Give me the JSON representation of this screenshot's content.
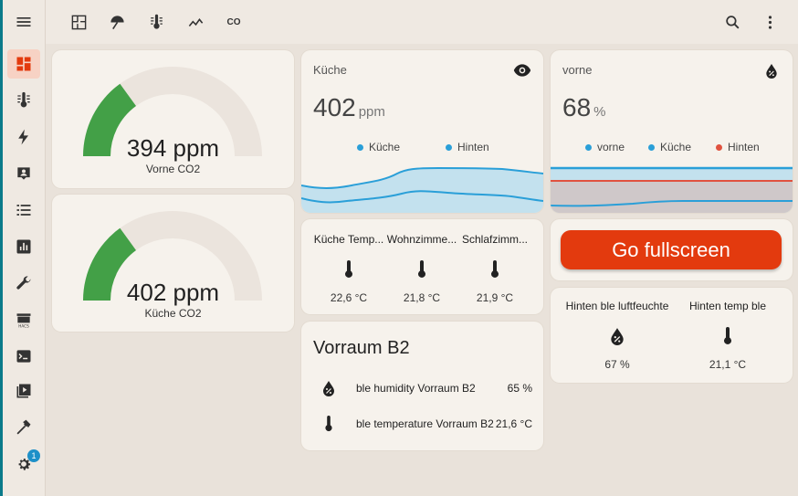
{
  "sidebar": {
    "items": [
      {
        "name": "overview",
        "icon": "dashboard-icon",
        "active": true
      },
      {
        "name": "climate",
        "icon": "thermometer-icon"
      },
      {
        "name": "energy",
        "icon": "lightning-icon"
      },
      {
        "name": "map",
        "icon": "account-box-icon"
      },
      {
        "name": "logbook",
        "icon": "list-icon"
      },
      {
        "name": "history",
        "icon": "chart-box-icon"
      },
      {
        "name": "tools",
        "icon": "wrench-icon"
      },
      {
        "name": "hacs",
        "icon": "hacs-store-icon",
        "label": "HACS"
      },
      {
        "name": "terminal",
        "icon": "terminal-icon"
      },
      {
        "name": "media",
        "icon": "media-play-icon"
      },
      {
        "name": "developer",
        "icon": "hammer-icon"
      },
      {
        "name": "settings",
        "icon": "gear-icon",
        "badge": "1"
      }
    ]
  },
  "topbar": {
    "views": [
      "floorplan-icon",
      "weather-icon",
      "thermometer-icon",
      "trend-icon",
      "co-icon"
    ],
    "co_label": "CO"
  },
  "gauges": [
    {
      "value": "394 ppm",
      "name": "Vorne CO2",
      "fraction": 0.3
    },
    {
      "value": "402 ppm",
      "name": "Küche CO2",
      "fraction": 0.3
    }
  ],
  "sensor_kueche": {
    "name": "Küche",
    "value": "402",
    "unit": "ppm",
    "legend": [
      "Küche",
      "Hinten"
    ]
  },
  "sensor_vorne": {
    "name": "vorne",
    "value": "68",
    "unit": "%",
    "legend": [
      "vorne",
      "Küche",
      "Hinten"
    ]
  },
  "temps_card": {
    "entities": [
      {
        "name": "Küche Temp...",
        "state": "22,6 °C"
      },
      {
        "name": "Wohnzimme...",
        "state": "21,8 °C"
      },
      {
        "name": "Schlafzimm...",
        "state": "21,9 °C"
      }
    ]
  },
  "fullscreen_button": {
    "label": "Go fullscreen"
  },
  "hinten_card": {
    "entities": [
      {
        "name": "Hinten ble luftfeuchte",
        "state": "67 %"
      },
      {
        "name": "Hinten temp ble",
        "state": "21,1 °C"
      }
    ]
  },
  "vorraum_card": {
    "title": "Vorraum B2",
    "rows": [
      {
        "name": "ble humidity Vorraum B2",
        "value": "65 %",
        "icon": "water-percent-icon"
      },
      {
        "name": "ble temperature Vorraum B2",
        "value": "21,6 °C",
        "icon": "thermometer-icon"
      }
    ]
  },
  "colors": {
    "accent": "#e33a0e",
    "gauge_green": "#43a047",
    "series_blue": "#2a9fd8",
    "series_red": "#e0523f"
  }
}
